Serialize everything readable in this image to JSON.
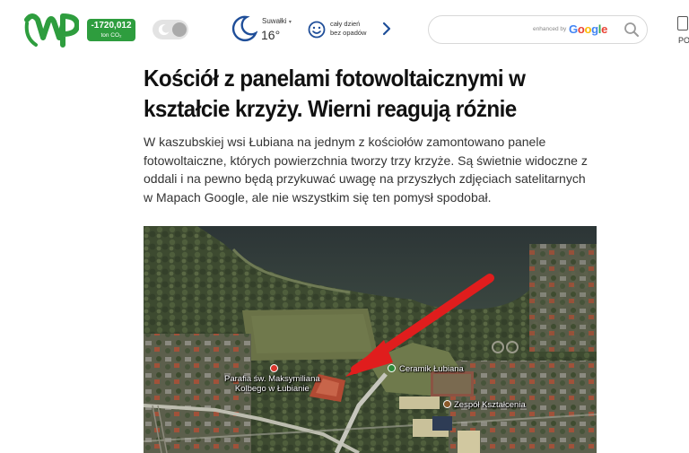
{
  "header": {
    "logo_alt": "WP",
    "co2": {
      "value": "-1720,012",
      "unit": "ton CO₂"
    },
    "theme_toggle": {
      "state": "light"
    },
    "weather": {
      "city": "Suwałki",
      "city_caret": "▾",
      "temperature": "16°",
      "description_line1": "cały dzień",
      "description_line2": "bez opadów"
    },
    "search": {
      "placeholder": "",
      "enhanced_by": "enhanced by",
      "google_letters": [
        "G",
        "o",
        "o",
        "g",
        "l",
        "e"
      ],
      "google_colors": [
        "#4285F4",
        "#EA4335",
        "#FBBC05",
        "#4285F4",
        "#34A853",
        "#EA4335"
      ]
    },
    "right_cut_label": "PO"
  },
  "article": {
    "title": "Kościół z panelami fotowoltaicznymi w kształcie krzyży. Wierni reagują różnie",
    "lead": "W kaszubskiej wsi Łubiana na jednym z kościołów zamontowano panele fotowoltaiczne, których powierzchnia tworzy trzy krzyże. Są świetnie widoczne z oddali i na pewno będą przykuwać uwagę na przyszłych zdjęciach satelitarnych w Mapach Google, ale nie wszystkim się ten pomysł spodobał.",
    "image": {
      "labels": {
        "parish_line1": "Parafia św. Maksymiliana",
        "parish_line2": "Kolbego w Łubianie",
        "ceramik": "Ceramik Łubiana",
        "zespol": "Zespół Kształcenia"
      }
    }
  },
  "colors": {
    "brand_green": "#2e9d3e",
    "arrow_red": "#e01d1d"
  }
}
